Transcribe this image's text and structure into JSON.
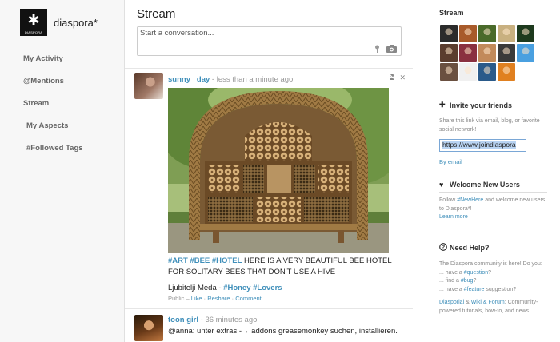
{
  "brand": {
    "name": "diaspora*",
    "logo_glyph": "✱",
    "logo_text": "DIASPORA"
  },
  "nav": [
    {
      "label": "My Activity"
    },
    {
      "label": "@Mentions"
    },
    {
      "label": "Stream"
    },
    {
      "label": "My Aspects"
    },
    {
      "label": "#Followed Tags"
    }
  ],
  "main": {
    "title": "Stream",
    "publisher": {
      "placeholder": "Start a conversation...",
      "icons": [
        "map-pin-icon",
        "camera-icon"
      ]
    }
  },
  "posts": [
    {
      "author": "sunny_ day",
      "time": " - less than a minute ago",
      "hashtags": "#ART #BEE #HOTEL",
      "text": " HERE IS A VERY BEAUTIFUL BEE HOTEL FOR SOLITARY BEES THAT DON'T USE A HIVE",
      "caption": "Ljubitelji Meda - ",
      "caption_tags": "#Honey #Lovers",
      "visibility": "Public",
      "actions": [
        "Like",
        "Reshare",
        "Comment"
      ],
      "image": "bee-hotel-photo"
    },
    {
      "author": "toon girl",
      "time": " - 36 minutes ago",
      "text": "@anna: unter extras -→ addons greasemonkey suchen, installieren."
    }
  ],
  "right": {
    "stream_title": "Stream",
    "contacts": [
      "#2b2b2b",
      "#a85a2a",
      "#4a6a2a",
      "#c8b080",
      "#1e3a1e",
      "#5b3d2e",
      "#8a3040",
      "#c28a5a",
      "#3a3a3a",
      "#4aa0e0",
      "#6a5040",
      "#f0f0f0",
      "#2a5a8a",
      "#e08020"
    ],
    "invite": {
      "title": "Invite your friends",
      "text": "Share this link via email, blog, or favorite social network!",
      "url": "https://www.joindiaspora",
      "by_email": "By email"
    },
    "welcome": {
      "title": "Welcome New Users",
      "text_pre": "Follow ",
      "link": "#NewHere",
      "text_post": " and welcome new users to Diaspora*!",
      "more": "Learn more"
    },
    "help": {
      "title": "Need Help?",
      "intro": "The Diaspora community is here! Do you:",
      "items": [
        {
          "pre": "... have a ",
          "link": "#question",
          "post": "?"
        },
        {
          "pre": "... find a ",
          "link": "#bug",
          "post": "?"
        },
        {
          "pre": "... have a ",
          "link": "#feature",
          "post": " suggestion?"
        }
      ],
      "wiki_link": "Diasporial",
      "wiki_mid": " & ",
      "wiki_link2": "Wiki & Forum",
      "wiki_post": ": Community-powered tutorials, how-to, and news"
    }
  },
  "colors": {
    "link": "#3f8fba",
    "sidebar_bg": "#f7f7f7"
  }
}
